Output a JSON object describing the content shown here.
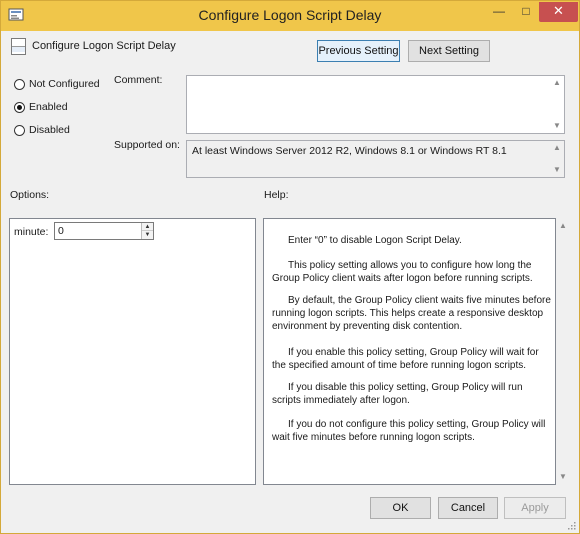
{
  "window": {
    "title": "Configure Logon Script Delay",
    "minimize_glyph": "—",
    "maximize_glyph": "□",
    "close_glyph": "✕"
  },
  "header": {
    "policy_name": "Configure Logon Script Delay",
    "previous_label": "Previous Setting",
    "next_label": "Next Setting"
  },
  "state": {
    "options": [
      "Not Configured",
      "Enabled",
      "Disabled"
    ],
    "selected": "Enabled"
  },
  "comment": {
    "label": "Comment:",
    "value": ""
  },
  "supported": {
    "label": "Supported on:",
    "value": "At least Windows Server 2012 R2, Windows 8.1 or Windows RT 8.1"
  },
  "options_section": {
    "label": "Options:",
    "minute_label": "minute:",
    "minute_value": "0"
  },
  "help_section": {
    "label": "Help:",
    "paragraphs": [
      "Enter “0” to disable Logon Script Delay.",
      "This policy setting allows you to configure how long the Group Policy client waits after logon before running scripts.",
      "By default, the Group Policy client waits five minutes before running logon scripts. This helps create a responsive desktop environment by preventing disk contention.",
      "If you enable this policy setting, Group Policy will wait for the specified amount of time before running logon scripts.",
      "If you disable this policy setting, Group Policy will run scripts immediately after logon.",
      "If you do not configure this policy setting, Group Policy will wait five minutes before running logon scripts."
    ]
  },
  "footer": {
    "ok_label": "OK",
    "cancel_label": "Cancel",
    "apply_label": "Apply"
  },
  "colors": {
    "titlebar": "#f0c64a",
    "close_button": "#c75050",
    "focused_button_border": "#3c7fb1"
  }
}
